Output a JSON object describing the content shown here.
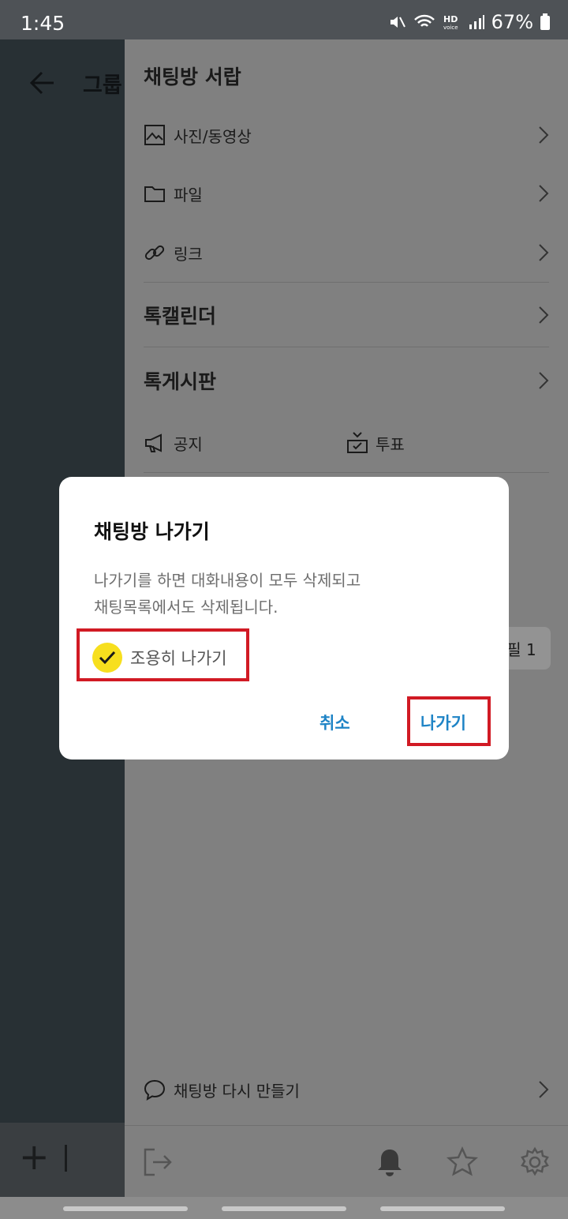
{
  "status_bar": {
    "time": "1:45",
    "battery": "67%"
  },
  "chat": {
    "title": "그룹"
  },
  "drawer": {
    "title": "채팅방 서랍",
    "items": [
      {
        "label": "사진/동영상",
        "icon": "photo-icon"
      },
      {
        "label": "파일",
        "icon": "folder-icon"
      },
      {
        "label": "링크",
        "icon": "link-icon"
      }
    ],
    "calendar": "톡캘린더",
    "board": "톡게시판",
    "notice": "공지",
    "vote": "투표",
    "pill": "필 1",
    "recreate": "채팅방 다시 만들기"
  },
  "dialog": {
    "title": "채팅방 나가기",
    "message_line1": "나가기를 하면 대화내용이 모두 삭제되고",
    "message_line2": "채팅목록에서도 삭제됩니다.",
    "quiet_leave": "조용히 나가기",
    "cancel": "취소",
    "leave": "나가기"
  },
  "colors": {
    "accent": "#1f84c6",
    "check": "#f7df1e",
    "highlight": "#d11a24"
  }
}
